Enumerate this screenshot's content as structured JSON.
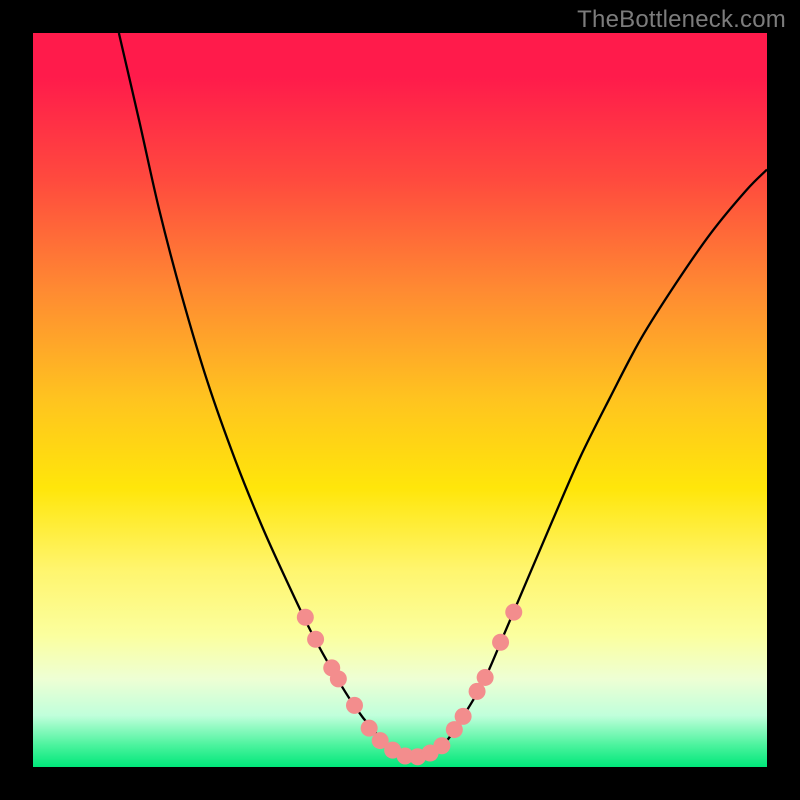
{
  "watermark": "TheBottleneck.com",
  "colors": {
    "frame": "#000000",
    "curve_stroke": "#000000",
    "dot_fill": "#f38d8d",
    "gradient_top": "#ff1b4b",
    "gradient_bottom": "#00e77a"
  },
  "chart_data": {
    "type": "line",
    "title": "",
    "xlabel": "",
    "ylabel": "",
    "xlim": [
      0,
      100
    ],
    "ylim": [
      0,
      100
    ],
    "note": "No axis ticks or numeric labels are rendered; all values are read directly off pixel positions within the 734×734 plot area, normalized to 0–100.",
    "series": [
      {
        "name": "curve",
        "x": [
          11.7,
          14.5,
          17.2,
          20.3,
          23.8,
          27.6,
          31.2,
          34.5,
          37.8,
          41.0,
          43.8,
          46.2,
          48.6,
          51.0,
          53.4,
          56.2,
          58.6,
          61.4,
          64.1,
          67.2,
          70.7,
          74.5,
          78.6,
          82.8,
          87.6,
          92.4,
          97.2,
          100.0
        ],
        "y": [
          100.0,
          87.9,
          75.9,
          64.1,
          52.4,
          41.7,
          32.8,
          25.5,
          18.6,
          12.8,
          8.3,
          5.2,
          2.8,
          1.4,
          1.4,
          3.4,
          6.9,
          11.7,
          17.9,
          25.2,
          33.4,
          42.1,
          50.3,
          58.3,
          65.9,
          72.8,
          78.6,
          81.4
        ]
      }
    ],
    "markers": {
      "name": "dots",
      "x": [
        37.1,
        38.5,
        40.7,
        41.6,
        43.8,
        45.8,
        47.3,
        49.0,
        50.7,
        52.4,
        54.1,
        55.7,
        57.4,
        58.6,
        60.5,
        61.6,
        63.7,
        65.5
      ],
      "y": [
        20.4,
        17.4,
        13.5,
        12.0,
        8.4,
        5.3,
        3.6,
        2.3,
        1.5,
        1.4,
        1.9,
        2.9,
        5.1,
        6.9,
        10.3,
        12.2,
        17.0,
        21.1
      ]
    }
  }
}
